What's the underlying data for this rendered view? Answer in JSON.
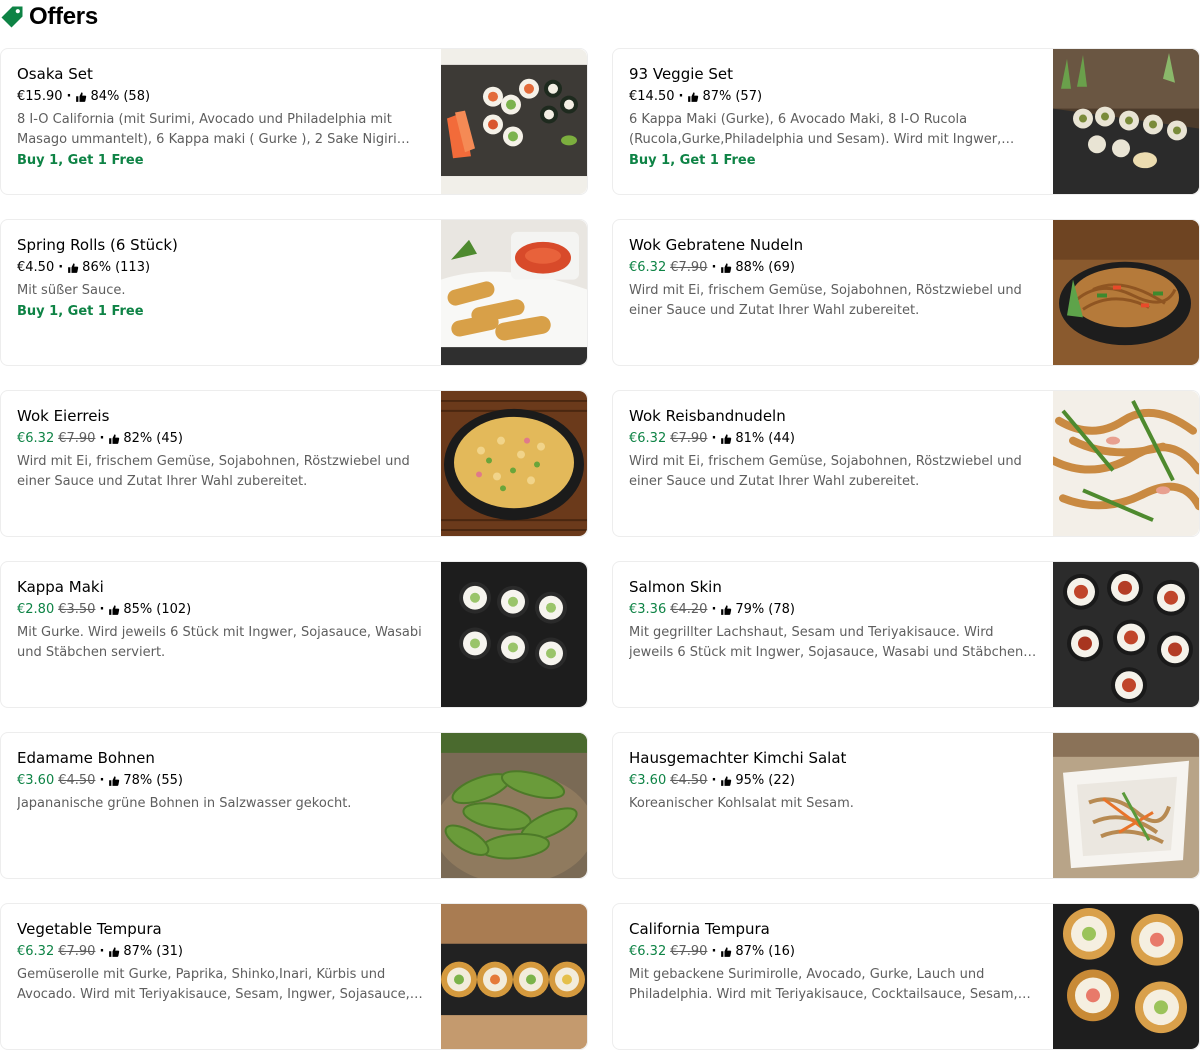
{
  "page": {
    "title": "Offers"
  },
  "colors": {
    "accent_green": "#0e8345",
    "muted_text": "#5e5e5e",
    "card_border": "#ededed"
  },
  "icons": {
    "section": "price-tag-icon",
    "rating": "thumbs-up-icon"
  },
  "items": [
    {
      "name": "Osaka Set",
      "price": "€15.90",
      "original_price": "",
      "rating": "84%",
      "count": "(58)",
      "description": "8 I-O California (mit Surimi, Avocado und Philadelphia mit Masago ummantelt), 6 Kappa maki ( Gurke ), 2 Sake Nigiri…",
      "promo": "Buy 1, Get 1 Free",
      "image": "osaka-set-image"
    },
    {
      "name": "93 Veggie Set",
      "price": "€14.50",
      "original_price": "",
      "rating": "87%",
      "count": "(57)",
      "description": "6 Kappa Maki (Gurke), 6 Avocado Maki, 8 I-O Rucola (Rucola,Gurke,Philadelphia und Sesam). Wird mit Ingwer,…",
      "promo": "Buy 1, Get 1 Free",
      "image": "veggie-set-image"
    },
    {
      "name": "Spring Rolls (6 Stück)",
      "price": "€4.50",
      "original_price": "",
      "rating": "86%",
      "count": "(113)",
      "description": "Mit süßer Sauce.",
      "promo": "Buy 1, Get 1 Free",
      "image": "spring-rolls-image"
    },
    {
      "name": "Wok Gebratene Nudeln",
      "price": "€6.32",
      "original_price": "€7.90",
      "rating": "88%",
      "count": "(69)",
      "description": "Wird mit Ei, frischem Gemüse, Sojabohnen, Röstzwiebel und einer Sauce und Zutat Ihrer Wahl zubereitet.",
      "promo": "",
      "image": "fried-noodles-image"
    },
    {
      "name": "Wok Eierreis",
      "price": "€6.32",
      "original_price": "€7.90",
      "rating": "82%",
      "count": "(45)",
      "description": "Wird mit Ei, frischem Gemüse, Sojabohnen, Röstzwiebel und einer Sauce und Zutat Ihrer Wahl zubereitet.",
      "promo": "",
      "image": "egg-fried-rice-image"
    },
    {
      "name": "Wok Reisbandnudeln",
      "price": "€6.32",
      "original_price": "€7.90",
      "rating": "81%",
      "count": "(44)",
      "description": "Wird mit Ei, frischem Gemüse, Sojabohnen, Röstzwiebel und einer Sauce und Zutat Ihrer Wahl zubereitet.",
      "promo": "",
      "image": "rice-noodles-image"
    },
    {
      "name": "Kappa Maki",
      "price": "€2.80",
      "original_price": "€3.50",
      "rating": "85%",
      "count": "(102)",
      "description": "Mit Gurke. Wird jeweils 6 Stück mit Ingwer, Sojasauce, Wasabi und Stäbchen serviert.",
      "promo": "",
      "image": "kappa-maki-image"
    },
    {
      "name": "Salmon Skin",
      "price": "€3.36",
      "original_price": "€4.20",
      "rating": "79%",
      "count": "(78)",
      "description": "Mit gegrillter Lachshaut, Sesam und Teriyakisauce. Wird jeweils 6 Stück mit Ingwer, Sojasauce, Wasabi und Stäbchen serviert.",
      "promo": "",
      "image": "salmon-skin-image"
    },
    {
      "name": "Edamame Bohnen",
      "price": "€3.60",
      "original_price": "€4.50",
      "rating": "78%",
      "count": "(55)",
      "description": "Japananische grüne Bohnen in Salzwasser gekocht.",
      "promo": "",
      "image": "edamame-image"
    },
    {
      "name": "Hausgemachter Kimchi Salat",
      "price": "€3.60",
      "original_price": "€4.50",
      "rating": "95%",
      "count": "(22)",
      "description": "Koreanischer Kohlsalat mit Sesam.",
      "promo": "",
      "image": "kimchi-salad-image"
    },
    {
      "name": "Vegetable Tempura",
      "price": "€6.32",
      "original_price": "€7.90",
      "rating": "87%",
      "count": "(31)",
      "description": "Gemüserolle mit Gurke, Paprika, Shinko,Inari, Kürbis und Avocado. Wird mit Teriyakisauce, Sesam, Ingwer, Sojasauce,…",
      "promo": "",
      "image": "vegetable-tempura-image"
    },
    {
      "name": "California Tempura",
      "price": "€6.32",
      "original_price": "€7.90",
      "rating": "87%",
      "count": "(16)",
      "description": "Mit gebackene Surimirolle, Avocado, Gurke, Lauch und Philadelphia. Wird mit Teriyakisauce, Cocktailsauce, Sesam,…",
      "promo": "",
      "image": "california-tempura-image"
    }
  ]
}
